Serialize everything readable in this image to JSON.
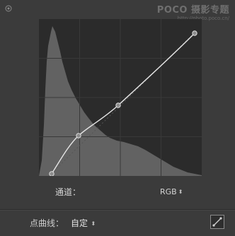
{
  "watermark": {
    "brand": "POCO 摄影专题",
    "url": "http://photo.poco.cn/"
  },
  "channel": {
    "label": "通道：",
    "value": "RGB"
  },
  "point_curve": {
    "label": "点曲线：",
    "value": "自定"
  },
  "icons": {
    "target": "target-adjustment-icon",
    "channel_chevron": "updown-chevron-icon",
    "curve_chevron": "updown-chevron-icon",
    "edit": "edit-point-curve-icon"
  },
  "colors": {
    "panel_bg": "#3b3b3b",
    "graph_bg": "#2a2a2a",
    "histogram": "#636363",
    "curve": "#e8e8e8"
  }
}
